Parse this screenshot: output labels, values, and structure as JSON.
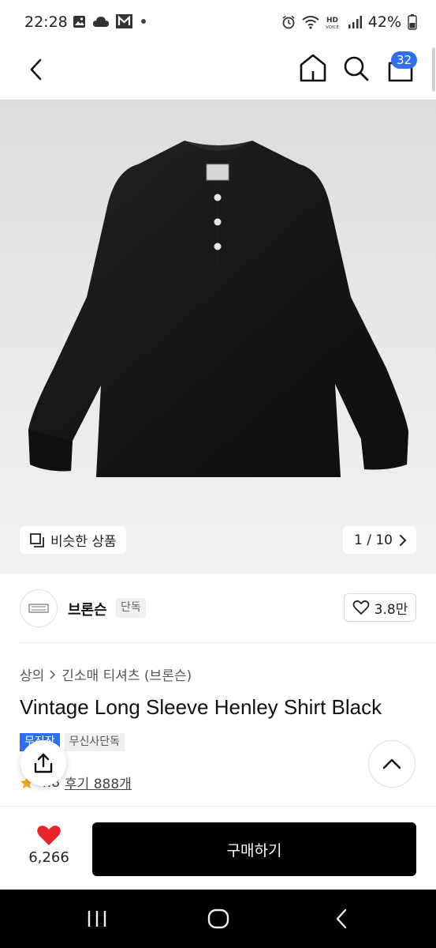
{
  "status_bar": {
    "time": "22:28",
    "left_icons": [
      "image-icon",
      "cloud-icon",
      "gmail-icon",
      "dot-icon"
    ],
    "right_icons": [
      "alarm-icon",
      "wifi-icon",
      "hd-voice-icon",
      "signal-icon"
    ],
    "battery": "42%"
  },
  "header": {
    "back_icon": "chevron-left-icon",
    "home_icon": "home-icon",
    "search_icon": "search-icon",
    "cart_icon": "cart-icon",
    "cart_count": "32"
  },
  "gallery": {
    "similar_label": "비슷한 상품",
    "counter": "1 / 10"
  },
  "brand": {
    "name": "브론슨",
    "tag": "단독",
    "likes": "3.8만"
  },
  "product": {
    "breadcrumb": [
      "상의",
      "긴소매 티셔츠 (브론슨)"
    ],
    "title": "Vintage Long Sleeve Henley Shirt Black",
    "tags": [
      "무진장",
      "무신사단독"
    ],
    "rating": "4.8",
    "reviews": "후기 888개"
  },
  "bottom": {
    "wish_count": "6,266",
    "buy_label": "구매하기"
  },
  "colors": {
    "accent": "#2f6ff2",
    "heart": "#e8262a",
    "buy": "#000000"
  }
}
